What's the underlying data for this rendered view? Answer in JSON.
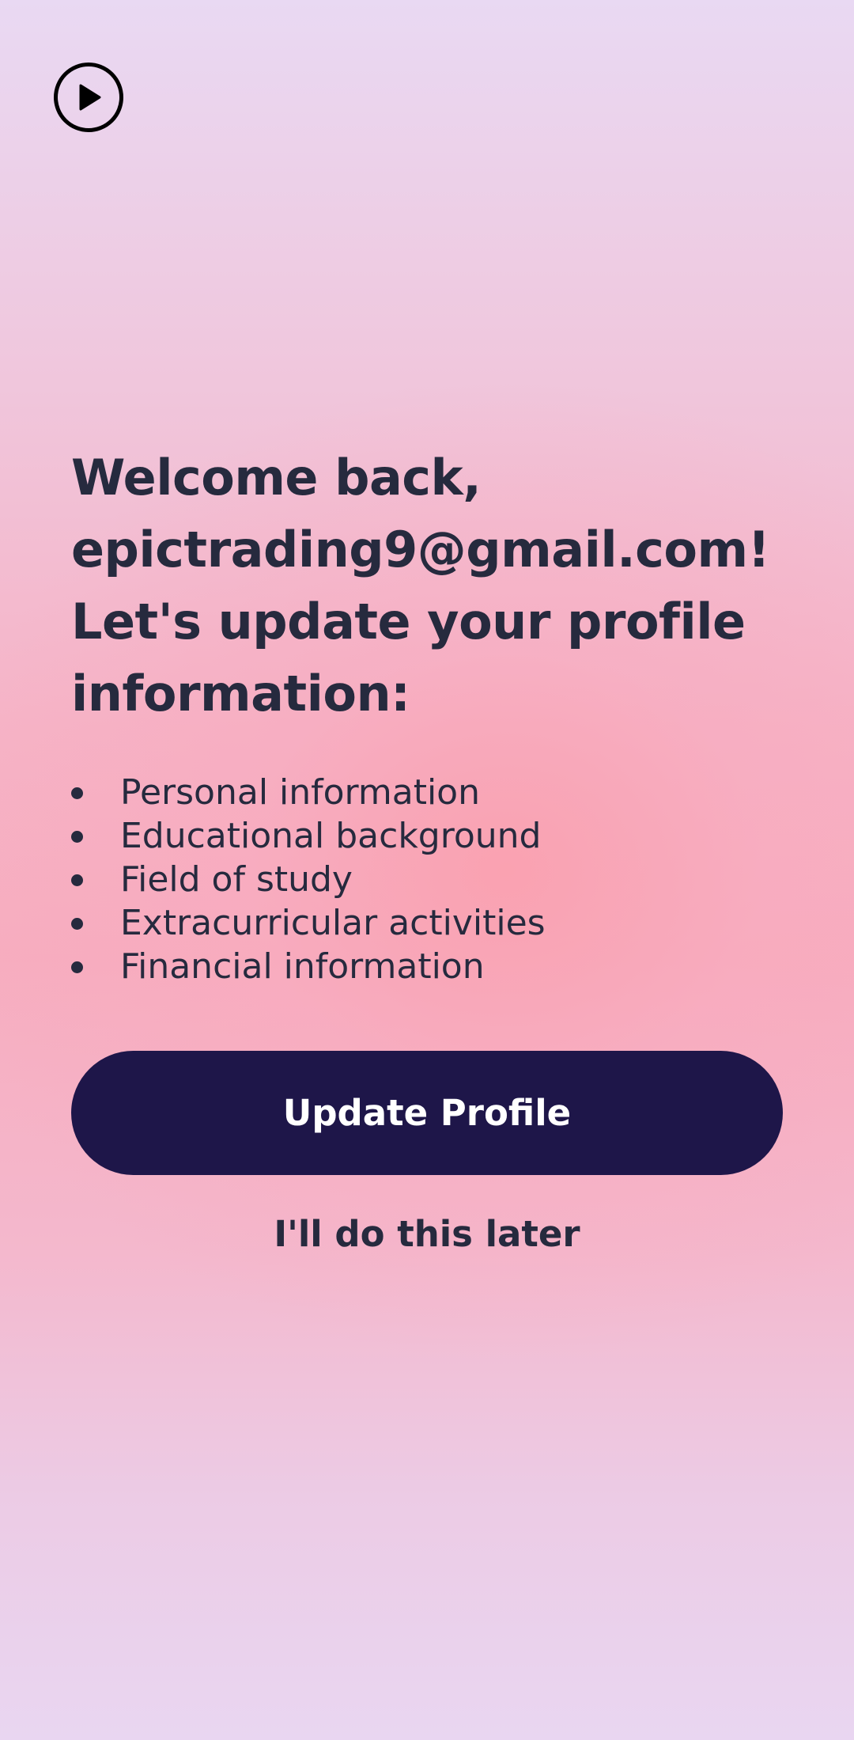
{
  "header": {
    "play_icon": "play-circle-icon"
  },
  "welcome": {
    "line1": "Welcome back,",
    "line2": "epictrading9@gmail.com!",
    "line3": "Let's update your profile",
    "line4": "information:"
  },
  "profile_sections": [
    "Personal information",
    "Educational background",
    "Field of study",
    "Extracurricular activities",
    "Financial information"
  ],
  "actions": {
    "update_label": "Update Profile",
    "later_label": "I'll do this later"
  },
  "colors": {
    "button_bg": "#1e1649",
    "text": "#262a3e"
  }
}
